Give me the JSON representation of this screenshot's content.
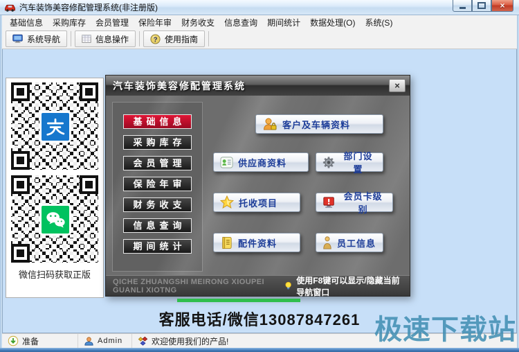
{
  "window": {
    "title": "汽车装饰美容修配管理系统(非注册版)",
    "controls": {
      "close_glyph": "×"
    }
  },
  "menu": {
    "items": [
      "基础信息",
      "采购库存",
      "会员管理",
      "保险年审",
      "财务收支",
      "信息查询",
      "期间统计",
      "数据处理(O)",
      "系统(S)"
    ]
  },
  "toolbar": {
    "buttons": [
      {
        "label": "系统导航",
        "icon": "monitor-icon"
      },
      {
        "label": "信息操作",
        "icon": "grid-icon"
      },
      {
        "label": "使用指南",
        "icon": "help-icon"
      }
    ]
  },
  "qr_panel": {
    "caption": "微信扫码获取正版",
    "codes": [
      {
        "name": "alipay-qr",
        "logo": "alipay"
      },
      {
        "name": "wechat-qr",
        "logo": "wechat"
      }
    ]
  },
  "dialog": {
    "title": "汽车装饰美容修配管理系统",
    "close_glyph": "×",
    "nav_items": [
      {
        "label": "基础信息",
        "active": true
      },
      {
        "label": "采购库存"
      },
      {
        "label": "会员管理"
      },
      {
        "label": "保险年审"
      },
      {
        "label": "财务收支"
      },
      {
        "label": "信息查询"
      },
      {
        "label": "期间统计"
      }
    ],
    "feature_buttons": [
      {
        "label": "客户及车辆资料",
        "icon": "customer-vehicle-icon"
      },
      {
        "label": "供应商资料",
        "icon": "supplier-icon"
      },
      {
        "label": "部门设置",
        "icon": "gear-icon"
      },
      {
        "label": "托收项目",
        "icon": "star-icon"
      },
      {
        "label": "会员卡级别",
        "icon": "alert-monitor-icon"
      },
      {
        "label": "配件资料",
        "icon": "notebook-icon"
      },
      {
        "label": "员工信息",
        "icon": "person-icon"
      }
    ],
    "footer": {
      "pinyin": "QICHE ZHUANGSHI MEIRONG XIOUPEI GUANLI XIOTNG",
      "hint": "使用F8键可以显示/隐藏当前导航窗口",
      "hint_icon": "bulb-icon"
    }
  },
  "service_line": "客服电话/微信13087847261",
  "watermark": "极速下载站",
  "status_bar": {
    "ready": "准备",
    "user": "Admin",
    "welcome": "欢迎使用我们的产品!"
  },
  "colors": {
    "active_nav_red": "#cf1228",
    "dialog_bg": "#6d6d6d",
    "feature_text_blue": "#1d3d99",
    "green_bar": "#2fbe4d",
    "alipay_blue": "#1677cd",
    "wechat_green": "#00c25f",
    "watermark_blue": "#3e8db2",
    "client_bg": "#c7dff8"
  }
}
